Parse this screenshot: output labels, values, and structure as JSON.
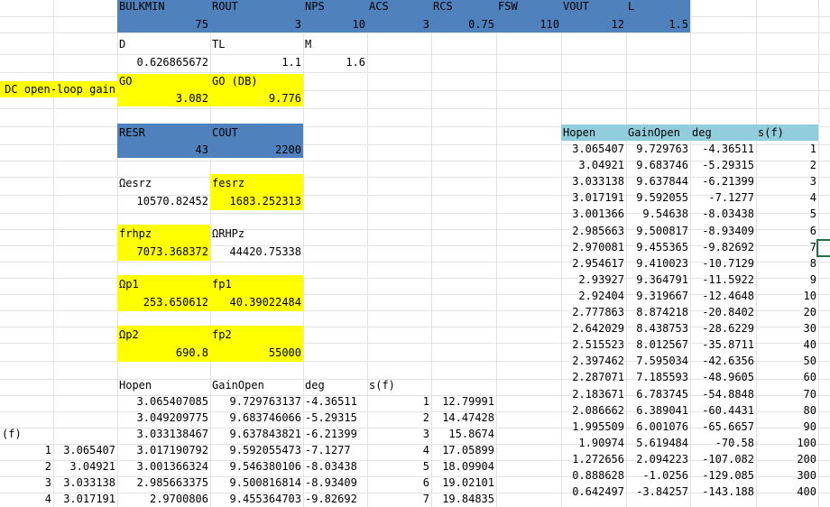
{
  "row0_headers": [
    "BULKMIN",
    "ROUT",
    "NPS",
    "ACS",
    "RCS",
    "FSW",
    "VOUT",
    "L"
  ],
  "row1_values": [
    "75",
    "3",
    "10",
    "3",
    "0.75",
    "110",
    "12",
    "1.5"
  ],
  "d_section": {
    "labels": [
      "D",
      "TL",
      "M"
    ],
    "values": [
      "0.626865672",
      "1.1",
      "1.6"
    ]
  },
  "gain_section": {
    "title": "DC open-loop gain",
    "labels": [
      "GO",
      "GO (DB)"
    ],
    "values": [
      "3.082",
      "9.776"
    ]
  },
  "esr_section": {
    "labels": [
      "RESR",
      "COUT"
    ],
    "values": [
      "43",
      "2200"
    ]
  },
  "omega_esrz": {
    "labels": [
      "Ωesrz",
      "fesrz"
    ],
    "values": [
      "10570.82452",
      "1683.252313"
    ]
  },
  "frhpz": {
    "labels": [
      "frhpz",
      "ΩRHPz"
    ],
    "values": [
      "7073.368372",
      "44420.75338"
    ]
  },
  "omega_p1": {
    "labels": [
      "Ωp1",
      "fp1"
    ],
    "values": [
      "253.650612",
      "40.39022484"
    ]
  },
  "omega_p2": {
    "labels": [
      "Ωp2",
      "fp2"
    ],
    "values": [
      "690.8",
      "55000"
    ]
  },
  "bottom_table": {
    "headers": [
      "Hopen",
      "GainOpen",
      "deg",
      "s(f)"
    ],
    "rows": [
      [
        "3.065407085",
        "9.729763137",
        "-4.36511",
        "1",
        "12.79991"
      ],
      [
        "3.049209775",
        "9.683746066",
        "-5.29315",
        "2",
        "14.47428"
      ],
      [
        "3.033138467",
        "9.637843821",
        "-6.21399",
        "3",
        "15.8674"
      ],
      [
        "3.017190792",
        "9.592055473",
        "-7.1277",
        "4",
        "17.05899"
      ],
      [
        "3.001366324",
        "9.546380106",
        "-8.03438",
        "5",
        "18.09904"
      ],
      [
        "2.985663375",
        "9.500816814",
        "-8.93409",
        "6",
        "19.02101"
      ],
      [
        "2.9700806",
        "9.455364703",
        "-9.82692",
        "7",
        "19.84835"
      ]
    ]
  },
  "left_table": {
    "header": "(f)",
    "rows": [
      [
        "1",
        "3.065407"
      ],
      [
        "2",
        "3.04921"
      ],
      [
        "3",
        "3.033138"
      ],
      [
        "4",
        "3.017191"
      ]
    ]
  },
  "right_table": {
    "headers": [
      "Hopen",
      "GainOpen",
      "deg",
      "s(f)"
    ],
    "rows": [
      [
        "3.065407",
        "9.729763",
        "-4.36511",
        "1"
      ],
      [
        "3.04921",
        "9.683746",
        "-5.29315",
        "2"
      ],
      [
        "3.033138",
        "9.637844",
        "-6.21399",
        "3"
      ],
      [
        "3.017191",
        "9.592055",
        "-7.1277",
        "4"
      ],
      [
        "3.001366",
        "9.54638",
        "-8.03438",
        "5"
      ],
      [
        "2.985663",
        "9.500817",
        "-8.93409",
        "6"
      ],
      [
        "2.970081",
        "9.455365",
        "-9.82692",
        "7"
      ],
      [
        "2.954617",
        "9.410023",
        "-10.7129",
        "8"
      ],
      [
        "2.93927",
        "9.364791",
        "-11.5922",
        "9"
      ],
      [
        "2.92404",
        "9.319667",
        "-12.4648",
        "10"
      ],
      [
        "2.777863",
        "8.874218",
        "-20.8402",
        "20"
      ],
      [
        "2.642029",
        "8.438753",
        "-28.6229",
        "30"
      ],
      [
        "2.515523",
        "8.012567",
        "-35.8711",
        "40"
      ],
      [
        "2.397462",
        "7.595034",
        "-42.6356",
        "50"
      ],
      [
        "2.287071",
        "7.185593",
        "-48.9605",
        "60"
      ],
      [
        "2.183671",
        "6.783745",
        "-54.8848",
        "70"
      ],
      [
        "2.086662",
        "6.389041",
        "-60.4431",
        "80"
      ],
      [
        "1.995509",
        "6.001076",
        "-65.6657",
        "90"
      ],
      [
        "1.90974",
        "5.619484",
        "-70.58",
        "100"
      ],
      [
        "1.272656",
        "2.094223",
        "-107.082",
        "200"
      ],
      [
        "0.888628",
        "-1.0256",
        "-129.085",
        "300"
      ],
      [
        "0.642497",
        "-3.84257",
        "-143.188",
        "400"
      ]
    ]
  },
  "colors": {
    "blue": "#4f81bd",
    "light_blue": "#92cddc",
    "yellow": "#ffff00",
    "selection": "#217346"
  }
}
